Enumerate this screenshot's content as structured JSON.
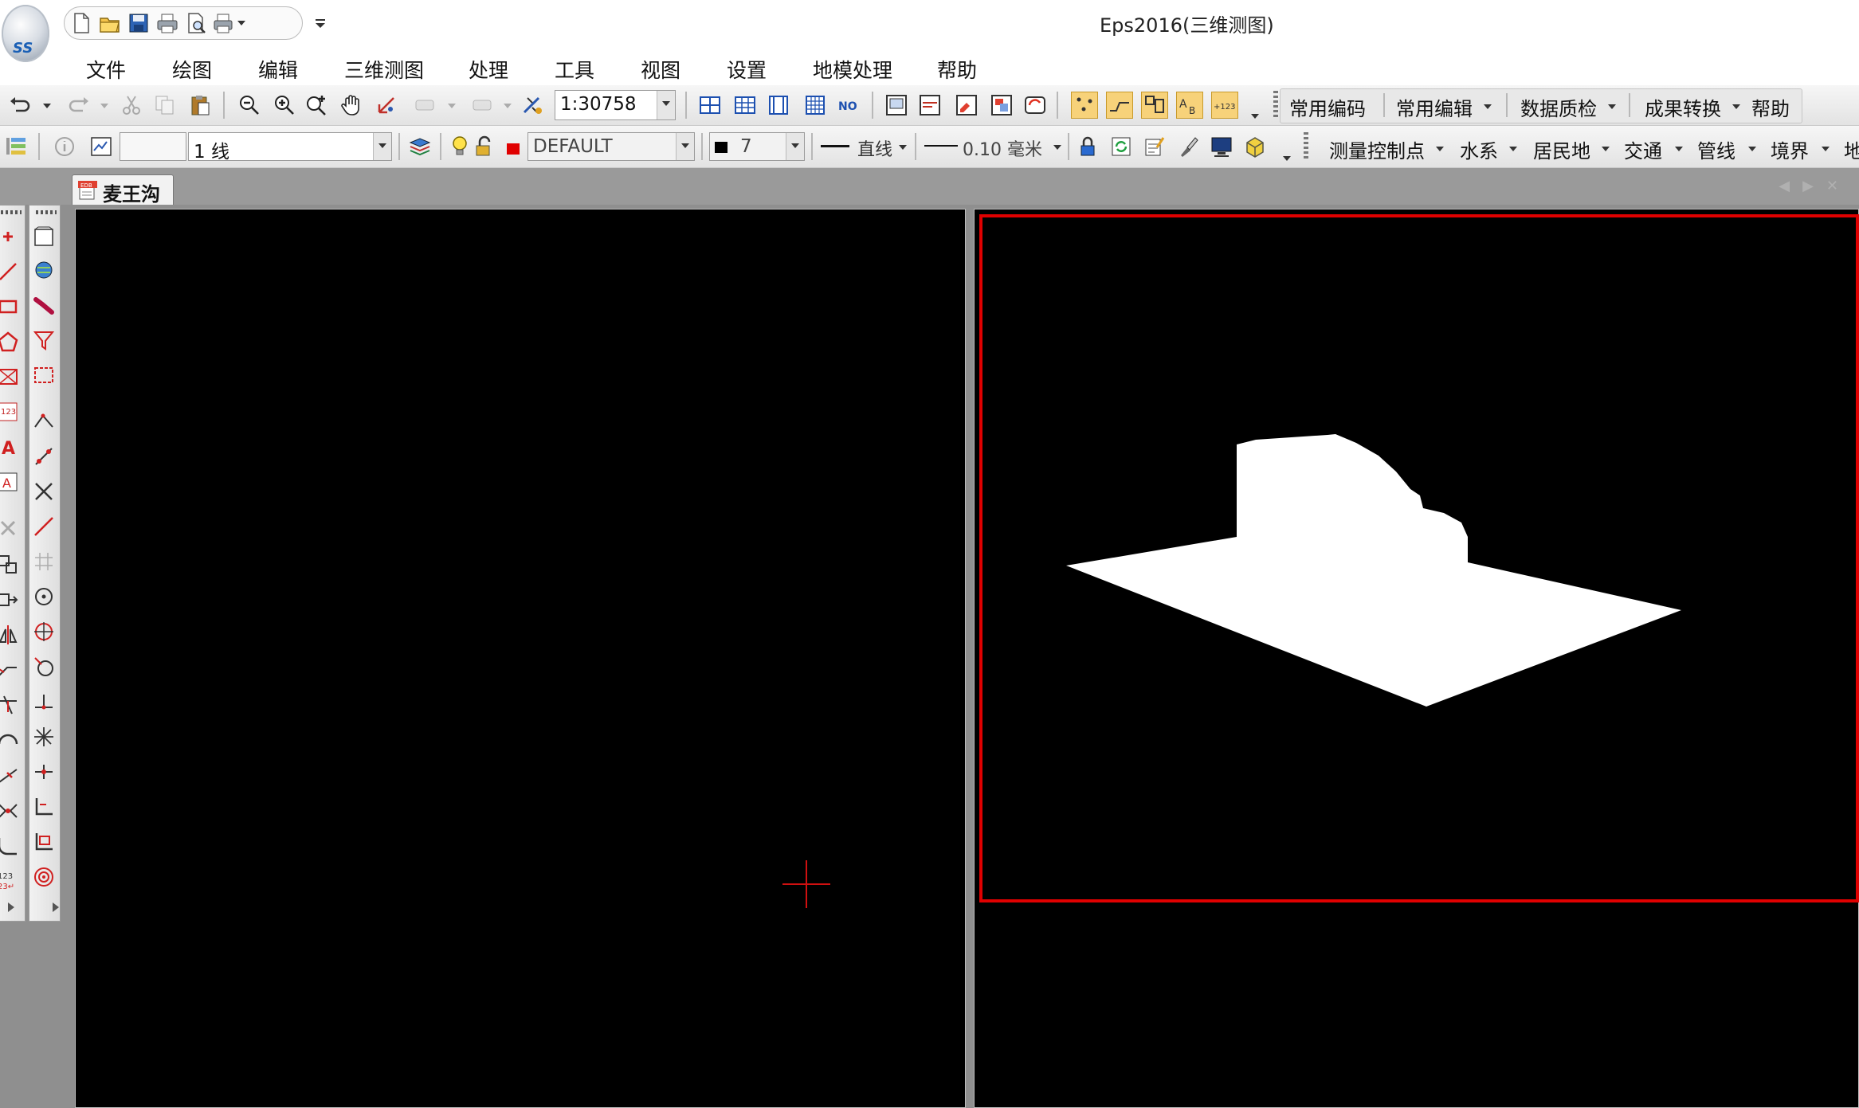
{
  "app": {
    "window_title": "Eps2016(三维测图)",
    "orb_text": "SS",
    "quick_access": [
      "new-icon",
      "open-icon",
      "save-icon",
      "print-icon",
      "print-preview-icon",
      "print-dropdown-icon"
    ]
  },
  "menu": {
    "items": [
      "文件",
      "绘图",
      "编辑",
      "三维测图",
      "处理",
      "工具",
      "视图",
      "设置",
      "地模处理",
      "帮助"
    ]
  },
  "toolbar1": {
    "scale_value": "1:30758",
    "ribbon_menus": [
      "常用编码",
      "常用编辑",
      "数据质检",
      "成果转换",
      "帮助"
    ]
  },
  "toolbar2": {
    "layer_field": "1 线",
    "layer_name": "DEFAULT",
    "color_value": "7",
    "linetype": "直线",
    "lineweight": "0.10 毫米",
    "category_menus": [
      "测量控制点",
      "水系",
      "居民地",
      "交通",
      "管线",
      "境界",
      "地"
    ]
  },
  "document": {
    "tab_label": "麦王沟",
    "tab_icon_text": "EDB"
  },
  "colors": {
    "active_viewport_border": "#e00000",
    "crosshair": "#d01010",
    "model_fill": "#ffffff"
  }
}
